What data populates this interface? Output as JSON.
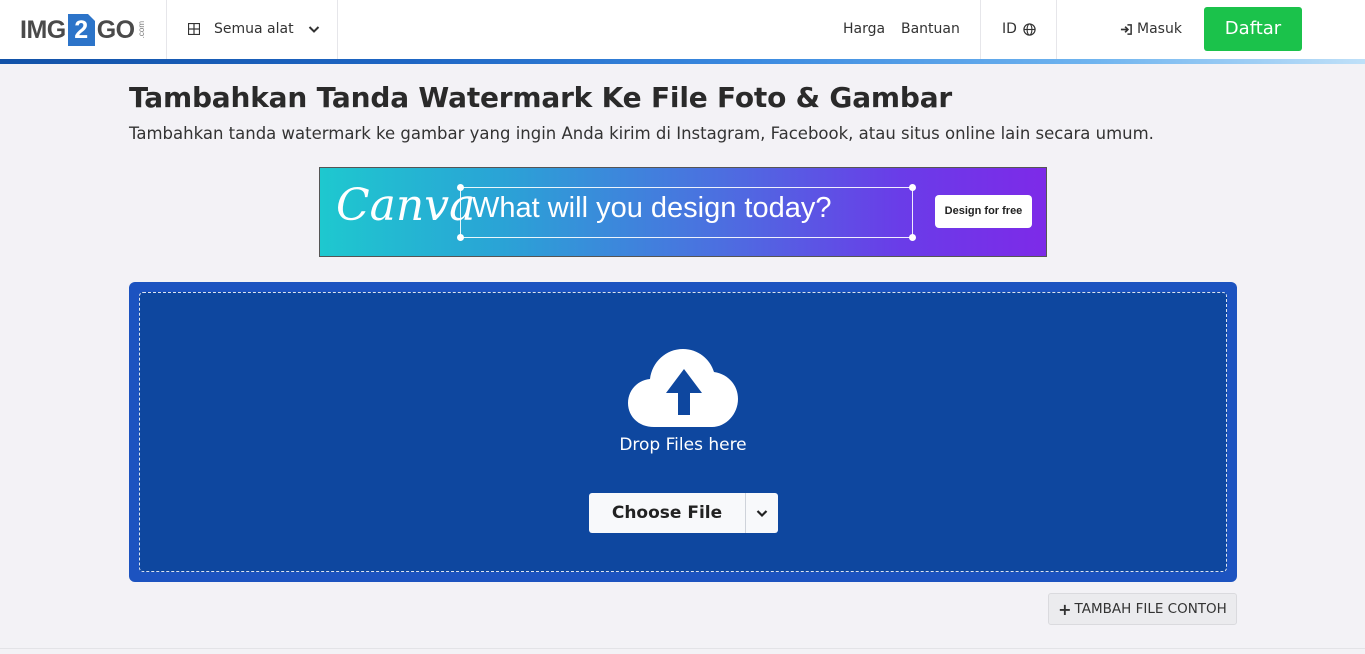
{
  "header": {
    "logo": {
      "left": "IMG",
      "num": "2",
      "right": "GO",
      "suffix": ".com"
    },
    "tools_label": "Semua alat",
    "nav": {
      "pricing": "Harga",
      "help": "Bantuan"
    },
    "language": "ID",
    "login": "Masuk",
    "signup": "Daftar"
  },
  "page": {
    "title": "Tambahkan Tanda Watermark Ke File Foto & Gambar",
    "subtitle": "Tambahkan tanda watermark ke gambar yang ingin Anda kirim di Instagram, Facebook, atau situs online lain secara umum."
  },
  "ad": {
    "brand": "Canva",
    "tagline": "What will you design today?",
    "cta": "Design for free"
  },
  "upload": {
    "drop_text": "Drop Files here",
    "choose_label": "Choose File",
    "sample_label": "TAMBAH FILE CONTOH"
  },
  "colors": {
    "signup_green": "#1bc24b",
    "drop_outer": "#1c53c0",
    "drop_inner": "#0e479f",
    "logo_blue": "#2c74c9"
  },
  "icons": [
    "grid-icon",
    "chevron-down-icon",
    "globe-icon",
    "sign-in-icon",
    "cloud-upload-icon",
    "plus-icon"
  ]
}
